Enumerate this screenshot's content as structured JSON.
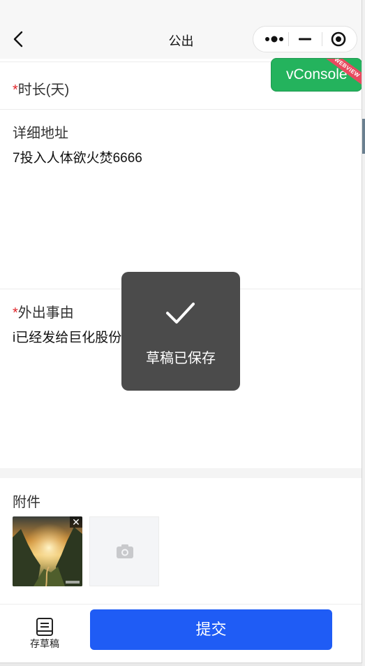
{
  "navbar": {
    "title": "公出",
    "back_icon": "chevron-left-icon",
    "capsule": {
      "more_icon": "more-dots-icon",
      "minimize_icon": "minimize-icon",
      "close_icon": "target-icon"
    }
  },
  "vconsole": {
    "label": "vConsole",
    "ribbon": "WEBVIEW",
    "color": "#24b35d"
  },
  "form": {
    "duration": {
      "required_mark": "*",
      "label": "时长(天)",
      "value": ""
    },
    "address": {
      "label": "详细地址",
      "value": "7投入人体欲火焚6666"
    },
    "reason": {
      "required_mark": "*",
      "label": "外出事由",
      "value": "i已经发给巨化股份"
    },
    "attachment": {
      "label": "附件",
      "close_icon": "close-icon",
      "upload_icon": "camera-icon"
    }
  },
  "footer": {
    "draft_label": "存草稿",
    "draft_icon": "draft-document-icon",
    "submit_label": "提交",
    "accent": "#1f5cf5"
  },
  "toast": {
    "icon": "check-icon",
    "message": "草稿已保存"
  }
}
